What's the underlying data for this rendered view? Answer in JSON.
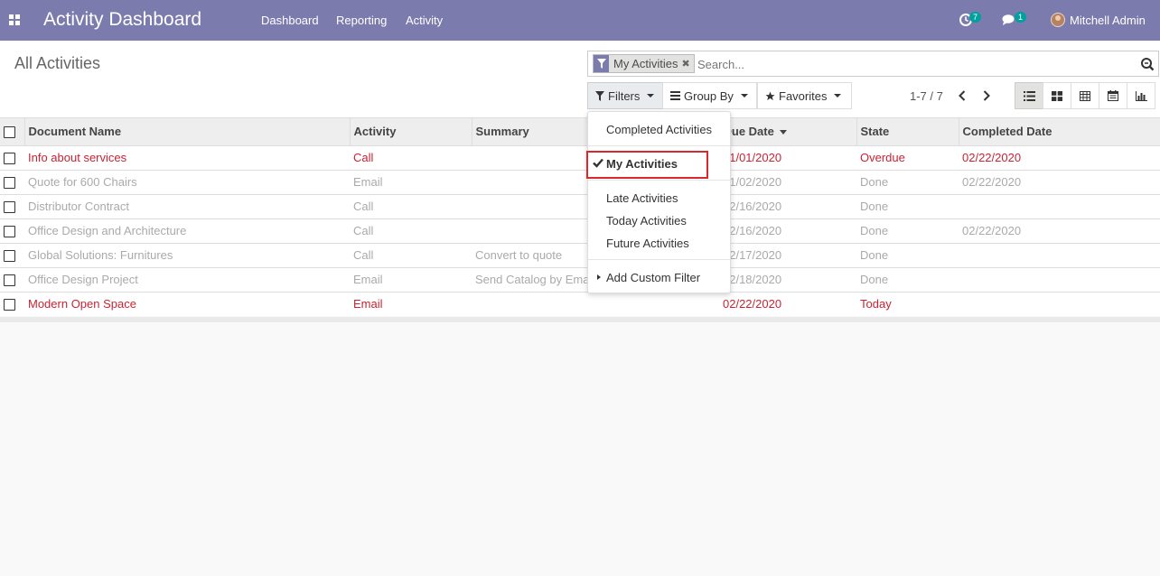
{
  "navbar": {
    "app_title": "Activity Dashboard",
    "menu": [
      "Dashboard",
      "Reporting",
      "Activity"
    ],
    "activity_count": "7",
    "message_count": "1",
    "user_name": "Mitchell Admin",
    "accent": "#7c7bad"
  },
  "control_panel": {
    "title": "All Activities",
    "search": {
      "facet_label": "My Activities",
      "facet_icon": "filter-icon",
      "placeholder": "Search..."
    },
    "buttons": {
      "filters": "Filters",
      "group_by": "Group By",
      "favorites": "Favorites"
    },
    "pager": "1-7 / 7",
    "views": [
      "list-view-icon",
      "kanban-view-icon",
      "pivot-view-icon",
      "calendar-view-icon",
      "graph-view-icon"
    ]
  },
  "table": {
    "columns": [
      "Document Name",
      "Activity",
      "Summary",
      "Due Date",
      "State",
      "Completed Date"
    ],
    "rows": [
      {
        "name": "Info about services",
        "activity": "Call",
        "summary": "",
        "due": "01/01/2020",
        "state": "Overdue",
        "completed": "02/22/2020",
        "status": "late"
      },
      {
        "name": "Quote for 600 Chairs",
        "activity": "Email",
        "summary": "",
        "due": "01/02/2020",
        "state": "Done",
        "completed": "02/22/2020",
        "status": "done"
      },
      {
        "name": "Distributor Contract",
        "activity": "Call",
        "summary": "",
        "due": "02/16/2020",
        "state": "Done",
        "completed": "",
        "status": "done"
      },
      {
        "name": "Office Design and Architecture",
        "activity": "Call",
        "summary": "",
        "due": "02/16/2020",
        "state": "Done",
        "completed": "02/22/2020",
        "status": "done"
      },
      {
        "name": "Global Solutions: Furnitures",
        "activity": "Call",
        "summary": "Convert to quote",
        "due": "02/17/2020",
        "state": "Done",
        "completed": "",
        "status": "done"
      },
      {
        "name": "Office Design Project",
        "activity": "Email",
        "summary": "Send Catalog by Email",
        "due": "02/18/2020",
        "state": "Done",
        "completed": "",
        "status": "done"
      },
      {
        "name": "Modern Open Space",
        "activity": "Email",
        "summary": "",
        "due": "02/22/2020",
        "state": "Today",
        "completed": "",
        "status": "late"
      }
    ]
  },
  "filters_dropdown": {
    "items": [
      "Completed Activities",
      "My Activities",
      "Late Activities",
      "Today Activities",
      "Future Activities",
      "Add Custom Filter"
    ],
    "selected": "My Activities"
  },
  "colors": {
    "late": "#c82333",
    "done": "#aaaaaa",
    "highlight": "#d9272e"
  }
}
